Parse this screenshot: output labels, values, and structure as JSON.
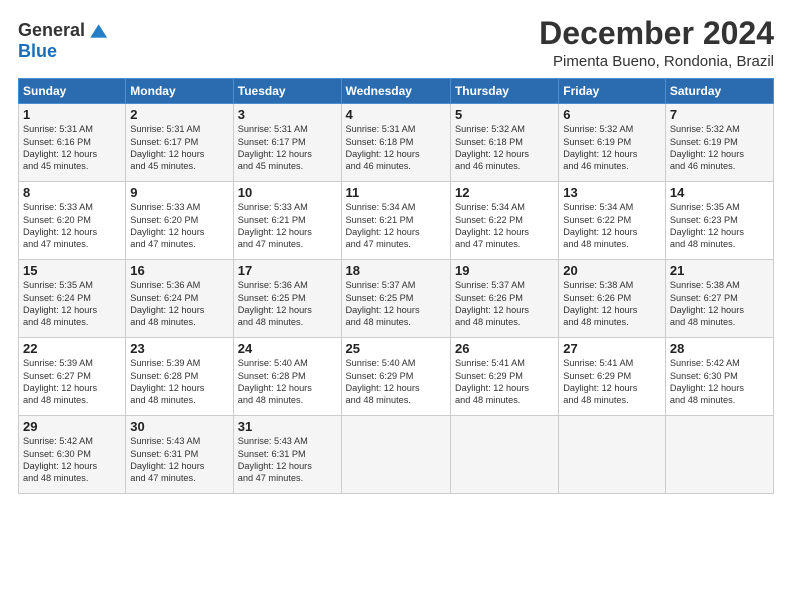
{
  "logo": {
    "general": "General",
    "blue": "Blue"
  },
  "title": "December 2024",
  "subtitle": "Pimenta Bueno, Rondonia, Brazil",
  "days_of_week": [
    "Sunday",
    "Monday",
    "Tuesday",
    "Wednesday",
    "Thursday",
    "Friday",
    "Saturday"
  ],
  "weeks": [
    [
      {
        "day": 1,
        "sunrise": "5:31 AM",
        "sunset": "6:16 PM",
        "daylight": "12 hours and 45 minutes."
      },
      {
        "day": 2,
        "sunrise": "5:31 AM",
        "sunset": "6:17 PM",
        "daylight": "12 hours and 45 minutes."
      },
      {
        "day": 3,
        "sunrise": "5:31 AM",
        "sunset": "6:17 PM",
        "daylight": "12 hours and 45 minutes."
      },
      {
        "day": 4,
        "sunrise": "5:31 AM",
        "sunset": "6:18 PM",
        "daylight": "12 hours and 46 minutes."
      },
      {
        "day": 5,
        "sunrise": "5:32 AM",
        "sunset": "6:18 PM",
        "daylight": "12 hours and 46 minutes."
      },
      {
        "day": 6,
        "sunrise": "5:32 AM",
        "sunset": "6:19 PM",
        "daylight": "12 hours and 46 minutes."
      },
      {
        "day": 7,
        "sunrise": "5:32 AM",
        "sunset": "6:19 PM",
        "daylight": "12 hours and 46 minutes."
      }
    ],
    [
      {
        "day": 8,
        "sunrise": "5:33 AM",
        "sunset": "6:20 PM",
        "daylight": "12 hours and 47 minutes."
      },
      {
        "day": 9,
        "sunrise": "5:33 AM",
        "sunset": "6:20 PM",
        "daylight": "12 hours and 47 minutes."
      },
      {
        "day": 10,
        "sunrise": "5:33 AM",
        "sunset": "6:21 PM",
        "daylight": "12 hours and 47 minutes."
      },
      {
        "day": 11,
        "sunrise": "5:34 AM",
        "sunset": "6:21 PM",
        "daylight": "12 hours and 47 minutes."
      },
      {
        "day": 12,
        "sunrise": "5:34 AM",
        "sunset": "6:22 PM",
        "daylight": "12 hours and 47 minutes."
      },
      {
        "day": 13,
        "sunrise": "5:34 AM",
        "sunset": "6:22 PM",
        "daylight": "12 hours and 48 minutes."
      },
      {
        "day": 14,
        "sunrise": "5:35 AM",
        "sunset": "6:23 PM",
        "daylight": "12 hours and 48 minutes."
      }
    ],
    [
      {
        "day": 15,
        "sunrise": "5:35 AM",
        "sunset": "6:24 PM",
        "daylight": "12 hours and 48 minutes."
      },
      {
        "day": 16,
        "sunrise": "5:36 AM",
        "sunset": "6:24 PM",
        "daylight": "12 hours and 48 minutes."
      },
      {
        "day": 17,
        "sunrise": "5:36 AM",
        "sunset": "6:25 PM",
        "daylight": "12 hours and 48 minutes."
      },
      {
        "day": 18,
        "sunrise": "5:37 AM",
        "sunset": "6:25 PM",
        "daylight": "12 hours and 48 minutes."
      },
      {
        "day": 19,
        "sunrise": "5:37 AM",
        "sunset": "6:26 PM",
        "daylight": "12 hours and 48 minutes."
      },
      {
        "day": 20,
        "sunrise": "5:38 AM",
        "sunset": "6:26 PM",
        "daylight": "12 hours and 48 minutes."
      },
      {
        "day": 21,
        "sunrise": "5:38 AM",
        "sunset": "6:27 PM",
        "daylight": "12 hours and 48 minutes."
      }
    ],
    [
      {
        "day": 22,
        "sunrise": "5:39 AM",
        "sunset": "6:27 PM",
        "daylight": "12 hours and 48 minutes."
      },
      {
        "day": 23,
        "sunrise": "5:39 AM",
        "sunset": "6:28 PM",
        "daylight": "12 hours and 48 minutes."
      },
      {
        "day": 24,
        "sunrise": "5:40 AM",
        "sunset": "6:28 PM",
        "daylight": "12 hours and 48 minutes."
      },
      {
        "day": 25,
        "sunrise": "5:40 AM",
        "sunset": "6:29 PM",
        "daylight": "12 hours and 48 minutes."
      },
      {
        "day": 26,
        "sunrise": "5:41 AM",
        "sunset": "6:29 PM",
        "daylight": "12 hours and 48 minutes."
      },
      {
        "day": 27,
        "sunrise": "5:41 AM",
        "sunset": "6:29 PM",
        "daylight": "12 hours and 48 minutes."
      },
      {
        "day": 28,
        "sunrise": "5:42 AM",
        "sunset": "6:30 PM",
        "daylight": "12 hours and 48 minutes."
      }
    ],
    [
      {
        "day": 29,
        "sunrise": "5:42 AM",
        "sunset": "6:30 PM",
        "daylight": "12 hours and 48 minutes."
      },
      {
        "day": 30,
        "sunrise": "5:43 AM",
        "sunset": "6:31 PM",
        "daylight": "12 hours and 47 minutes."
      },
      {
        "day": 31,
        "sunrise": "5:43 AM",
        "sunset": "6:31 PM",
        "daylight": "12 hours and 47 minutes."
      },
      null,
      null,
      null,
      null
    ]
  ]
}
